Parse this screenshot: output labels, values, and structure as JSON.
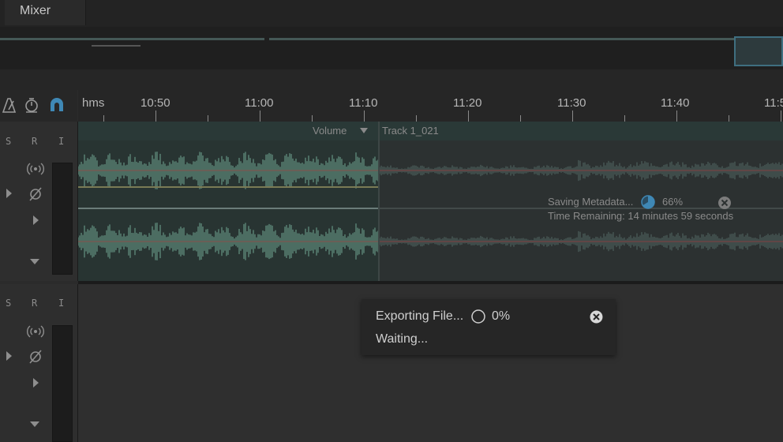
{
  "tabs": {
    "mixer": "Mixer"
  },
  "ruler": {
    "unit": "hms",
    "labels": [
      "10:50",
      "11:00",
      "11:10",
      "11:20",
      "11:30",
      "11:40",
      "11:5"
    ]
  },
  "track_header": {
    "solo": "S",
    "record": "R",
    "input": "I"
  },
  "clip": {
    "volume_label": "Volume",
    "name": "Track 1_021"
  },
  "saving_progress": {
    "label": "Saving Metadata...",
    "percent": "66%",
    "percent_value": 66,
    "time_remaining": "Time Remaining: 14 minutes 59 seconds"
  },
  "export_popup": {
    "label": "Exporting File...",
    "percent": "0%",
    "percent_value": 0,
    "status": "Waiting..."
  },
  "icons": {
    "toolbar": [
      "metronome-icon",
      "stopwatch-icon",
      "snap-magnet-icon"
    ],
    "header": [
      "monitor-broadcast-icon",
      "phase-invert-icon",
      "expand-arrow-icon",
      "collapse-arrow-icon"
    ],
    "popup": [
      "close-circle-icon"
    ]
  },
  "colors": {
    "accent": "#3f88b5",
    "waveform": "#5f8c7c",
    "waveform_dim": "#4a5a57",
    "level_line": "#b23b3b"
  }
}
